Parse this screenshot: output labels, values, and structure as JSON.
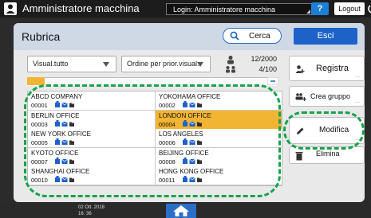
{
  "topbar": {
    "app_title": "Amministratore macchina",
    "login_text": "Login: Amministratore macchina",
    "help_label": "?",
    "logout_label": "Logout"
  },
  "header": {
    "title": "Rubrica",
    "search_label": "Cerca",
    "exit_label": "Esci"
  },
  "filters": {
    "view_select": "Visual.tutto",
    "order_select": "Ordine per prior.visual.",
    "count_total": "12/2000",
    "count_groups": "4/100"
  },
  "entries": [
    {
      "name": "ABCD COMPANY",
      "number": "00001",
      "selected": false
    },
    {
      "name": "YOKOHAMA OFFICE",
      "number": "00002",
      "selected": false
    },
    {
      "name": "BERLIN OFFICE",
      "number": "00003",
      "selected": false
    },
    {
      "name": "LONDON OFFICE",
      "number": "00004",
      "selected": true
    },
    {
      "name": "NEW YORK OFFICE",
      "number": "00005",
      "selected": false
    },
    {
      "name": "LOS ANGELES",
      "number": "00006",
      "selected": false
    },
    {
      "name": "KYOTO OFFICE",
      "number": "00007",
      "selected": false
    },
    {
      "name": "BEIJING OFFICE",
      "number": "00008",
      "selected": false
    },
    {
      "name": "SHANGHAI OFFICE",
      "number": "00010",
      "selected": false
    },
    {
      "name": "HONG KONG OFFICE",
      "number": "00011",
      "selected": false
    }
  ],
  "actions": {
    "register_label": "Registra",
    "create_group_label": "Crea gruppo",
    "edit_label": "Modifica",
    "delete_label": "Elimina",
    "more": "..."
  },
  "footer": {
    "date": "02 Ott. 2018",
    "time": "16: 36"
  },
  "colors": {
    "selected": "#f2b533",
    "accent_blue": "#1e62c9",
    "highlight_green": "#16a34a"
  },
  "icons": [
    "user-icon",
    "power-icon",
    "search-icon",
    "users-icon",
    "add-user-icon",
    "add-group-icon",
    "pencil-icon",
    "trash-icon",
    "home-icon",
    "fax-icon",
    "mail-icon",
    "folder-icon"
  ]
}
